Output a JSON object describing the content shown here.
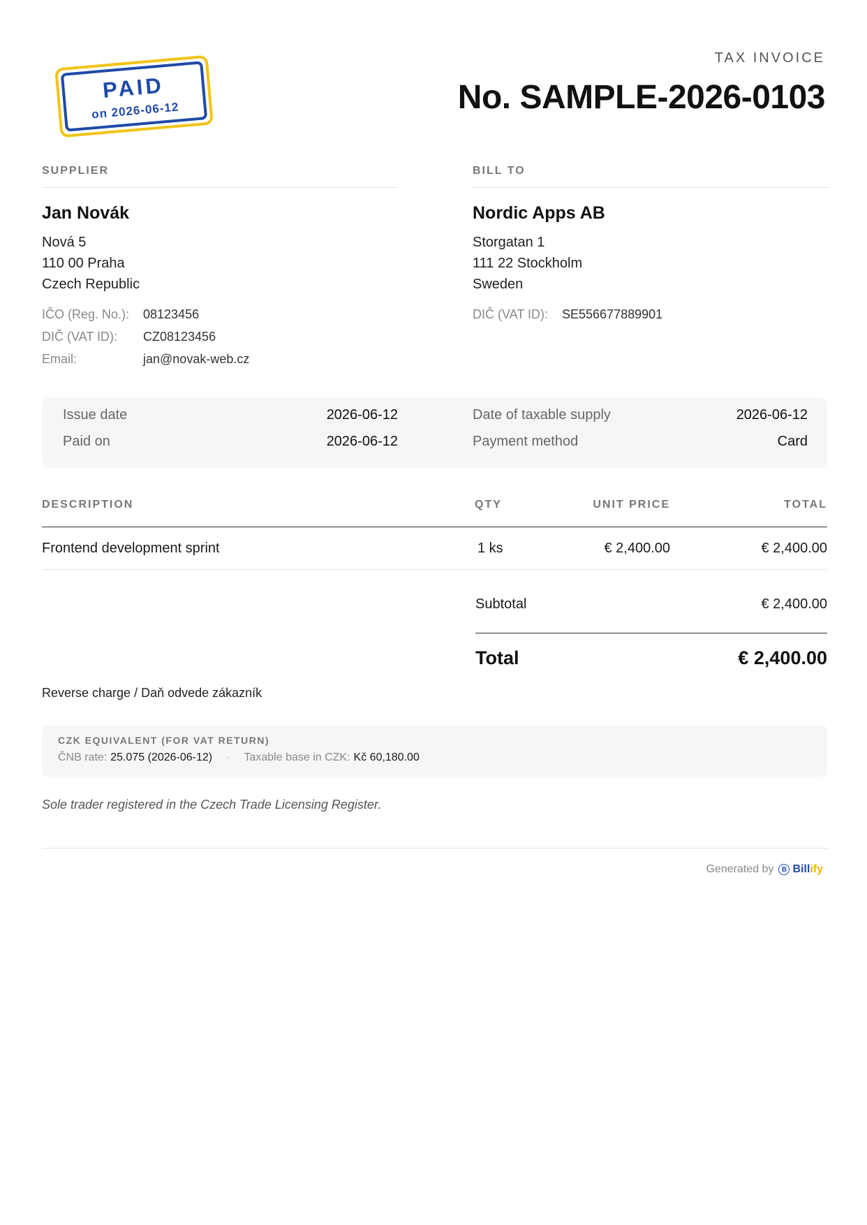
{
  "stamp": {
    "title": "PAID",
    "subtitle": "on 2026-06-12",
    "border_color": "#f2c418",
    "text_color": "#1f4aa8"
  },
  "header": {
    "doc_type": "TAX INVOICE",
    "number": "No. SAMPLE-2026-0103"
  },
  "supplier": {
    "section_label": "SUPPLIER",
    "name": "Jan Novák",
    "address": [
      "Nová 5",
      "110 00 Praha",
      "Czech Republic"
    ],
    "ids": [
      {
        "label": "IČO (Reg. No.):",
        "value": "08123456"
      },
      {
        "label": "DIČ (VAT ID):",
        "value": "CZ08123456"
      },
      {
        "label": "Email:",
        "value": "jan@novak-web.cz"
      }
    ]
  },
  "bill_to": {
    "section_label": "BILL TO",
    "name": "Nordic Apps AB",
    "address": [
      "Storgatan 1",
      "111 22 Stockholm",
      "Sweden"
    ],
    "ids": [
      {
        "label": "DIČ (VAT ID):",
        "value": "SE556677889901"
      }
    ]
  },
  "dates": {
    "issue_date": {
      "label": "Issue date",
      "value": "2026-06-12"
    },
    "paid_on": {
      "label": "Paid on",
      "value": "2026-06-12"
    },
    "taxable_supply": {
      "label": "Date of taxable supply",
      "value": "2026-06-12"
    },
    "payment_method": {
      "label": "Payment method",
      "value": "Card"
    }
  },
  "items": {
    "headers": {
      "description": "DESCRIPTION",
      "qty": "QTY",
      "unit_price": "UNIT PRICE",
      "total": "TOTAL"
    },
    "rows": [
      {
        "description": "Frontend development sprint",
        "qty": "1 ks",
        "unit_price": "€ 2,400.00",
        "total": "€ 2,400.00"
      }
    ]
  },
  "totals": {
    "subtotal_label": "Subtotal",
    "subtotal_value": "€ 2,400.00",
    "total_label": "Total",
    "total_value": "€ 2,400.00"
  },
  "reverse_charge": "Reverse charge / Daň odvede zákazník",
  "czk": {
    "title": "CZK EQUIVALENT (FOR VAT RETURN)",
    "rate_label": "ČNB rate:",
    "rate_value": "25.075 (2026-06-12)",
    "separator": "·",
    "base_label": "Taxable base in CZK:",
    "base_value": "Kč 60,180.00"
  },
  "note": "Sole trader registered in the Czech Trade Licensing Register.",
  "footer": {
    "generated_by": "Generated by",
    "brand_icon_letter": "B",
    "brand_part1": "Bill",
    "brand_part2": "ify",
    "brand_icon": "billify-logo-icon"
  }
}
